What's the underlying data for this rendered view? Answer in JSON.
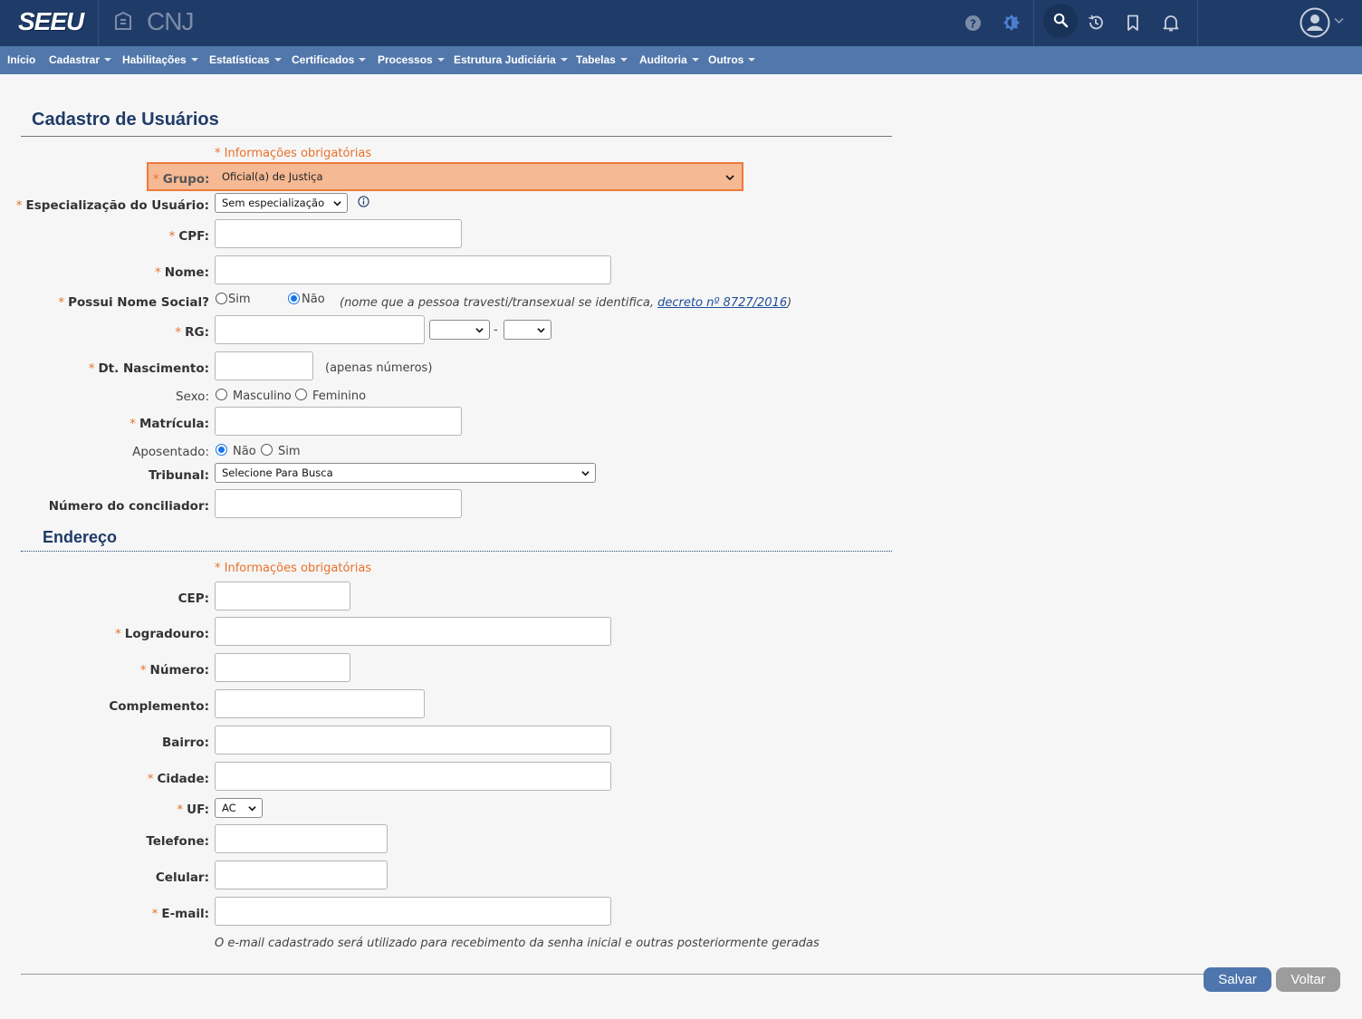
{
  "header": {
    "logo_seeu": "SEEU",
    "logo_cnj": "CNJ",
    "icons": [
      "help-icon",
      "contrast-icon",
      "search-icon",
      "history-icon",
      "bookmark-icon",
      "bell-icon",
      "user-avatar-icon"
    ]
  },
  "menu": {
    "items": [
      "Início",
      "Cadastrar",
      "Habilitações",
      "Estatísticas",
      "Certificados",
      "Processos",
      "Estrutura Judiciária",
      "Tabelas",
      "Auditoria",
      "Outros"
    ]
  },
  "page": {
    "title": "Cadastro de Usuários",
    "required_note": "* Informações obrigatórias"
  },
  "form": {
    "grupo_label": "Grupo:",
    "grupo_value": "Oficial(a) de Justiça",
    "especializacao_label": "Especialização do Usuário:",
    "especializacao_value": "Sem especialização",
    "cpf_label": "CPF:",
    "nome_label": "Nome:",
    "nome_social_label": "Possui Nome Social?",
    "nome_social_options": [
      "Sim",
      "Não"
    ],
    "nome_social_selected": "Não",
    "nome_social_hint": "(nome que a pessoa travesti/transexual se identifica, ",
    "nome_social_link": "decreto nº 8727/2016",
    "nome_social_hint_end": ")",
    "rg_label": "RG:",
    "rg_separator": "-",
    "nascimento_label": "Dt. Nascimento:",
    "nascimento_hint": "(apenas números)",
    "sexo_label": "Sexo:",
    "sexo_options": [
      "Masculino",
      "Feminino"
    ],
    "matricula_label": "Matrícula:",
    "aposentado_label": "Aposentado:",
    "aposentado_options": [
      "Não",
      "Sim"
    ],
    "aposentado_selected": "Não",
    "tribunal_label": "Tribunal:",
    "tribunal_value": "Selecione Para Busca",
    "conciliador_label": "Número do conciliador:"
  },
  "address": {
    "title": "Endereço",
    "required_note": "* Informações obrigatórias",
    "cep_label": "CEP:",
    "logradouro_label": "Logradouro:",
    "numero_label": "Número:",
    "complemento_label": "Complemento:",
    "bairro_label": "Bairro:",
    "cidade_label": "Cidade:",
    "uf_label": "UF:",
    "uf_value": "AC",
    "telefone_label": "Telefone:",
    "celular_label": "Celular:",
    "email_label": "E-mail:",
    "email_hint": "O e-mail cadastrado será utilizado para recebimento da senha inicial e outras posteriormente geradas"
  },
  "actions": {
    "save": "Salvar",
    "back": "Voltar"
  },
  "colors": {
    "header_bg": "#1f3b68",
    "menu_bg": "#5277aa",
    "required": "#e8702a",
    "highlight_bg": "#f5b994",
    "highlight_border": "#ef7a3b",
    "save_button": "#4f75ad",
    "back_button": "#9c9c9c"
  }
}
